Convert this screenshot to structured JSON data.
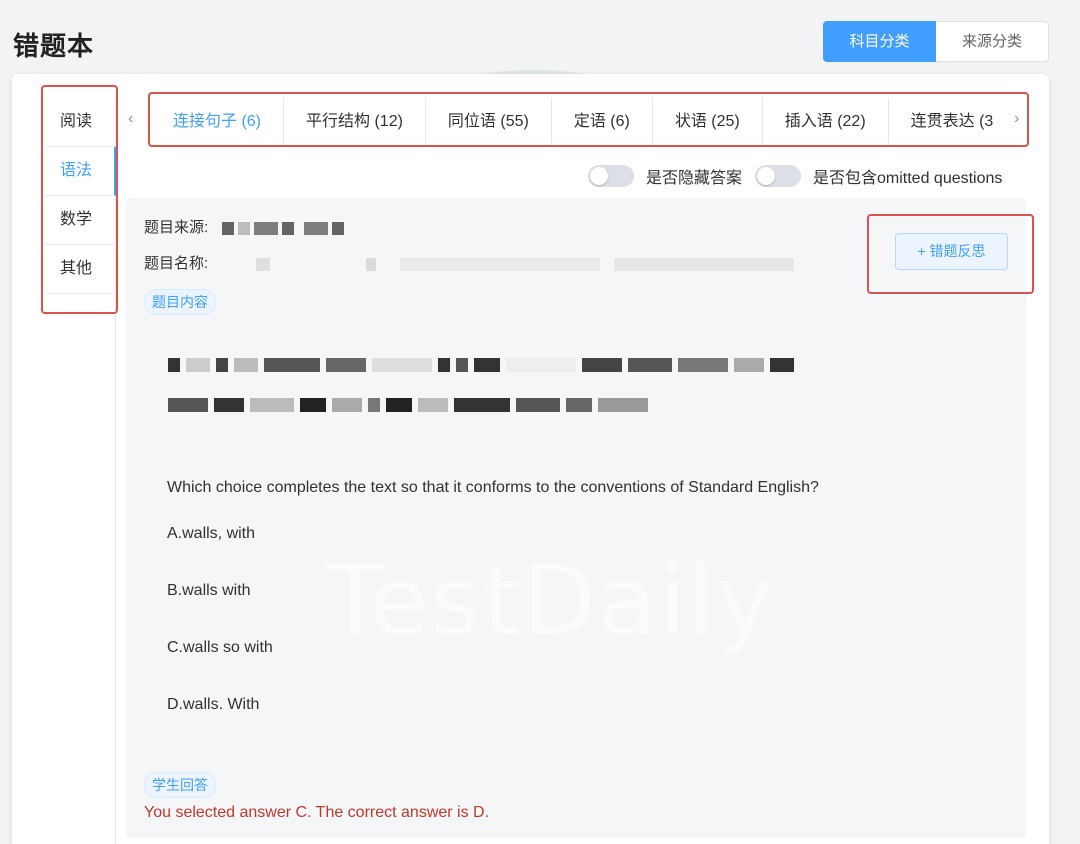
{
  "page": {
    "title": "错题本"
  },
  "view_switch": {
    "options": [
      "科目分类",
      "来源分类"
    ],
    "selected": "科目分类"
  },
  "subjects": {
    "items": [
      "阅读",
      "语法",
      "数学",
      "其他"
    ],
    "selected": "语法"
  },
  "topic_tabs": {
    "items": [
      "连接句子 (6)",
      "平行结构 (12)",
      "同位语 (55)",
      "定语 (6)",
      "状语 (25)",
      "插入语 (22)",
      "连贯表达 (3"
    ],
    "selected": "连接句子 (6)"
  },
  "toggles": {
    "hide_answers": {
      "label": "是否隐藏答案",
      "on": false
    },
    "include_omitted": {
      "label": "是否包含omitted questions",
      "on": false
    }
  },
  "question_card": {
    "source_label": "题目来源:",
    "name_label": "题目名称:",
    "content_tag": "题目内容",
    "reflect_button": "+ 错题反思",
    "question": "Which choice completes the text so that it conforms to the conventions of Standard English?",
    "options": [
      "A.walls, with",
      "B.walls with",
      "C.walls so with",
      "D.walls. With"
    ],
    "answer_tag": "学生回答",
    "feedback": "You selected answer C. The correct answer is D."
  },
  "watermark": {
    "text": "TestDaily"
  },
  "colors": {
    "accent": "#409eff",
    "annotation_red": "#d9534f",
    "feedback_red": "#c0392b"
  }
}
